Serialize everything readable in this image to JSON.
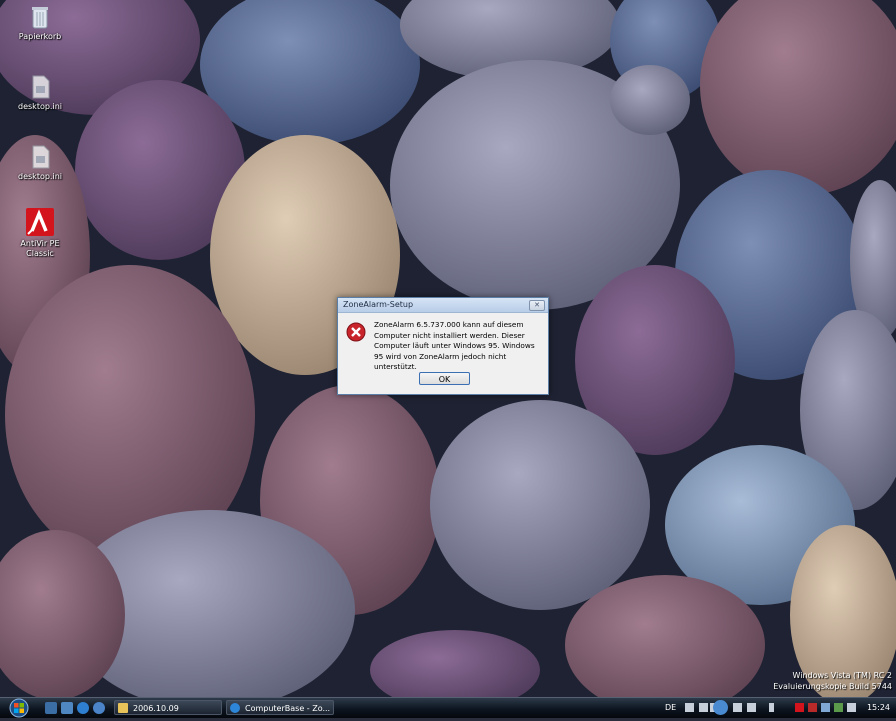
{
  "desktop": {
    "icons": [
      {
        "label": "Papierkorb",
        "icon": "recycle-bin-icon"
      },
      {
        "label": "desktop.ini",
        "icon": "ini-file-icon"
      },
      {
        "label": "desktop.ini",
        "icon": "ini-file-icon"
      },
      {
        "label": "AntiVir PE Classic",
        "icon": "antivir-icon"
      }
    ],
    "watermark": {
      "line1": "Windows Vista (TM) RC 2",
      "line2": "Evaluierungskopie Build 5744"
    }
  },
  "dialog": {
    "title": "ZoneAlarm-Setup",
    "close_label": "✕",
    "message": "ZoneAlarm 6.5.737.000 kann auf diesem Computer nicht installiert werden. Dieser Computer läuft unter Windows 95. Windows 95 wird von ZoneAlarm jedoch nicht unterstützt.",
    "ok_label": "OK",
    "icon": "error-icon"
  },
  "taskbar": {
    "tasks": [
      {
        "label": "2006.10.09",
        "icon": "folder-icon"
      },
      {
        "label": "ComputerBase - Zo...",
        "icon": "ie-icon"
      }
    ],
    "tray": {
      "language": "DE",
      "time": "15:24"
    }
  },
  "colors": {
    "dialog_border": "#5b7fa6",
    "error_red": "#c8242b",
    "antivir_red": "#d4141c",
    "taskbar": "#0d1520"
  }
}
